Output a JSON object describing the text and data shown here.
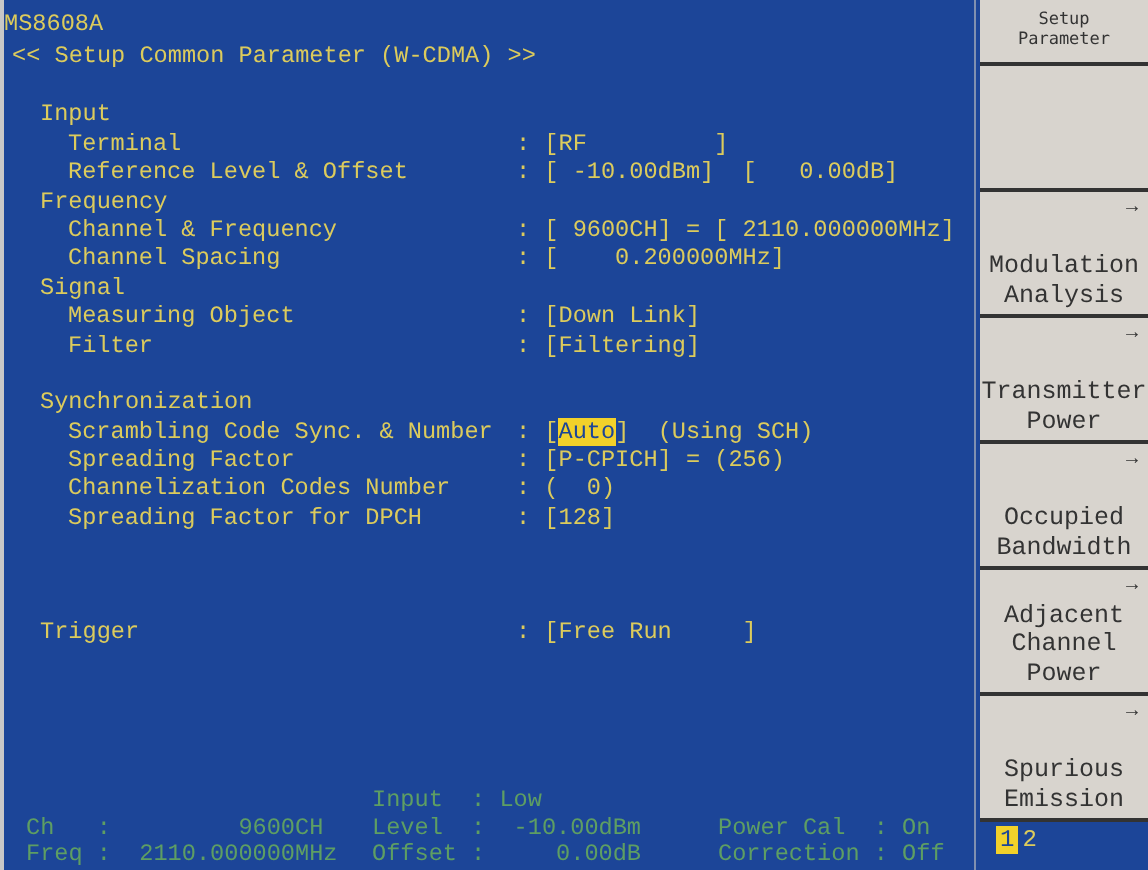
{
  "header": {
    "model": "MS8608A",
    "title": "<< Setup Common Parameter (W-CDMA) >>"
  },
  "parameters": [
    {
      "kind": "blank"
    },
    {
      "kind": "section",
      "label": "Input"
    },
    {
      "kind": "item",
      "label": "Terminal",
      "value": ": [RF         ]"
    },
    {
      "kind": "item",
      "label": "Reference Level & Offset",
      "value": ": [ -10.00dBm]  [   0.00dB]"
    },
    {
      "kind": "section",
      "label": "Frequency"
    },
    {
      "kind": "item",
      "label": "Channel & Frequency",
      "value": ": [ 9600CH] = [ 2110.000000MHz]"
    },
    {
      "kind": "item",
      "label": "Channel Spacing",
      "value": ": [    0.200000MHz]"
    },
    {
      "kind": "section",
      "label": "Signal"
    },
    {
      "kind": "item",
      "label": "Measuring Object",
      "value": ": [Down Link]"
    },
    {
      "kind": "item",
      "label": "Filter",
      "value": ": [Filtering]"
    },
    {
      "kind": "blank"
    },
    {
      "kind": "section",
      "label": "Synchronization"
    },
    {
      "kind": "item",
      "label": "Scrambling Code Sync. & Number",
      "value_parts": [
        {
          "text": ": [",
          "highlighted": false
        },
        {
          "text": "Auto",
          "highlighted": true
        },
        {
          "text": "]  (Using SCH)",
          "highlighted": false
        }
      ]
    },
    {
      "kind": "item",
      "label": "Spreading Factor",
      "value": ": [P-CPICH] = (256)"
    },
    {
      "kind": "item",
      "label": "Channelization Codes Number",
      "value": ": (  0)"
    },
    {
      "kind": "item",
      "label": "Spreading Factor for DPCH",
      "value": ": [128]"
    },
    {
      "kind": "blank"
    },
    {
      "kind": "blank"
    },
    {
      "kind": "blank"
    },
    {
      "kind": "section",
      "label": "Trigger",
      "value": ": [Free Run     ]"
    }
  ],
  "status_bar": {
    "columns": [
      [
        "Ch   :         9600CH",
        "Freq :  2110.000000MHz"
      ],
      [
        "Input  : Low",
        "Level  :  -10.00dBm",
        "Offset :     0.00dB"
      ],
      [
        "Power Cal  : On",
        "Correction : Off"
      ]
    ]
  },
  "softkeys": {
    "title": "Setup Parameter",
    "keys": [
      {
        "kind": "blank"
      },
      {
        "kind": "menu",
        "label": "Modulation Analysis",
        "arrow": "→"
      },
      {
        "kind": "menu",
        "label": "Transmitter Power",
        "arrow": "→"
      },
      {
        "kind": "menu",
        "label": "Occupied Bandwidth",
        "arrow": "→"
      },
      {
        "kind": "menu",
        "label": "Adjacent Channel Power",
        "arrow": "→"
      },
      {
        "kind": "menu",
        "label": "Spurious Emission",
        "arrow": "→"
      }
    ],
    "pages": [
      {
        "label": "1",
        "selected": true
      },
      {
        "label": "2",
        "selected": false
      }
    ]
  }
}
